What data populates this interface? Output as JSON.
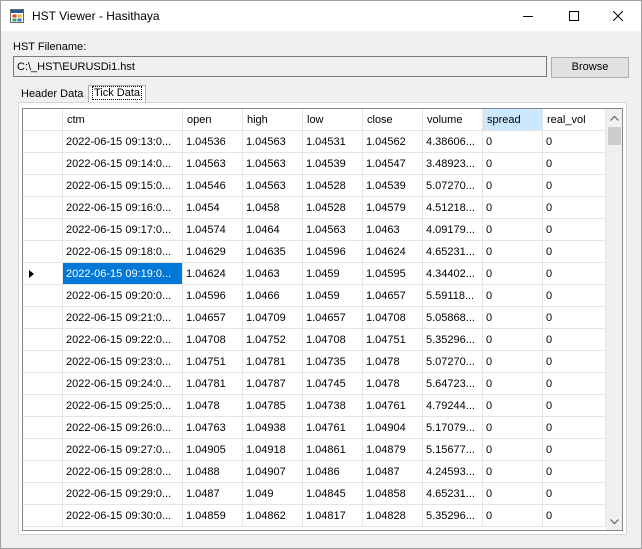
{
  "window": {
    "title": "HST Viewer - Hasithaya",
    "icon": "app-window-icon",
    "controls": {
      "minimize": "minimize-icon",
      "maximize": "maximize-icon",
      "close": "close-icon"
    }
  },
  "file": {
    "label": "HST Filename:",
    "path": "C:\\_HST\\EURUSDi1.hst",
    "browse_label": "Browse"
  },
  "tabs": [
    {
      "label": "Header Data",
      "selected": false
    },
    {
      "label": "Tick Data",
      "selected": true
    }
  ],
  "grid": {
    "columns": [
      "ctm",
      "open",
      "high",
      "low",
      "close",
      "volume",
      "spread",
      "real_vol"
    ],
    "selected_column": "spread",
    "current_row": 6,
    "rows": [
      [
        "2022-06-15 09:13:0...",
        "1.04536",
        "1.04563",
        "1.04531",
        "1.04562",
        "4.38606...",
        "0",
        "0"
      ],
      [
        "2022-06-15 09:14:0...",
        "1.04563",
        "1.04563",
        "1.04539",
        "1.04547",
        "3.48923...",
        "0",
        "0"
      ],
      [
        "2022-06-15 09:15:0...",
        "1.04546",
        "1.04563",
        "1.04528",
        "1.04539",
        "5.07270...",
        "0",
        "0"
      ],
      [
        "2022-06-15 09:16:0...",
        "1.0454",
        "1.0458",
        "1.04528",
        "1.04579",
        "4.51218...",
        "0",
        "0"
      ],
      [
        "2022-06-15 09:17:0...",
        "1.04574",
        "1.0464",
        "1.04563",
        "1.0463",
        "4.09179...",
        "0",
        "0"
      ],
      [
        "2022-06-15 09:18:0...",
        "1.04629",
        "1.04635",
        "1.04596",
        "1.04624",
        "4.65231...",
        "0",
        "0"
      ],
      [
        "2022-06-15 09:19:0...",
        "1.04624",
        "1.0463",
        "1.0459",
        "1.04595",
        "4.34402...",
        "0",
        "0"
      ],
      [
        "2022-06-15 09:20:0...",
        "1.04596",
        "1.0466",
        "1.0459",
        "1.04657",
        "5.59118...",
        "0",
        "0"
      ],
      [
        "2022-06-15 09:21:0...",
        "1.04657",
        "1.04709",
        "1.04657",
        "1.04708",
        "5.05868...",
        "0",
        "0"
      ],
      [
        "2022-06-15 09:22:0...",
        "1.04708",
        "1.04752",
        "1.04708",
        "1.04751",
        "5.35296...",
        "0",
        "0"
      ],
      [
        "2022-06-15 09:23:0...",
        "1.04751",
        "1.04781",
        "1.04735",
        "1.0478",
        "5.07270...",
        "0",
        "0"
      ],
      [
        "2022-06-15 09:24:0...",
        "1.04781",
        "1.04787",
        "1.04745",
        "1.0478",
        "5.64723...",
        "0",
        "0"
      ],
      [
        "2022-06-15 09:25:0...",
        "1.0478",
        "1.04785",
        "1.04738",
        "1.04761",
        "4.79244...",
        "0",
        "0"
      ],
      [
        "2022-06-15 09:26:0...",
        "1.04763",
        "1.04938",
        "1.04761",
        "1.04904",
        "5.17079...",
        "0",
        "0"
      ],
      [
        "2022-06-15 09:27:0...",
        "1.04905",
        "1.04918",
        "1.04861",
        "1.04879",
        "5.15677...",
        "0",
        "0"
      ],
      [
        "2022-06-15 09:28:0...",
        "1.0488",
        "1.04907",
        "1.0486",
        "1.0487",
        "4.24593...",
        "0",
        "0"
      ],
      [
        "2022-06-15 09:29:0...",
        "1.0487",
        "1.049",
        "1.04845",
        "1.04858",
        "4.65231...",
        "0",
        "0"
      ],
      [
        "2022-06-15 09:30:0...",
        "1.04859",
        "1.04862",
        "1.04817",
        "1.04828",
        "5.35296...",
        "0",
        "0"
      ]
    ]
  }
}
